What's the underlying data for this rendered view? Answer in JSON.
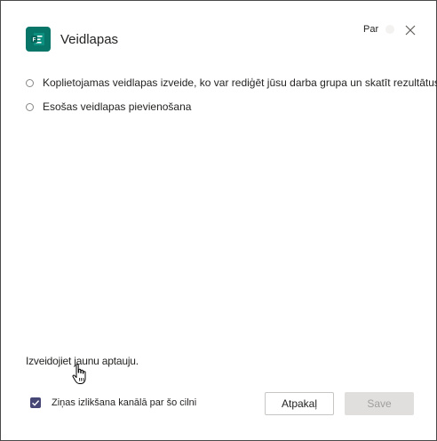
{
  "dialog": {
    "title": "Veidlapas",
    "about_label": "Par",
    "app_icon": "forms-icon",
    "close_icon": "close-icon",
    "brand_color": "#077568"
  },
  "options": [
    {
      "label": "Koplietojamas veidlapas izveide, ko var rediģēt jūsu darba grupa un skatīt rezultātus",
      "selected": false
    },
    {
      "label": "Esošas veidlapas pievienošana",
      "selected": false
    }
  ],
  "create_link": "Izveidojiet jaunu aptauju.",
  "post_to_channel": {
    "label": "Ziņas izlikšana kanālā par šo cilni",
    "checked": true,
    "check_color": "#464775"
  },
  "buttons": {
    "back": "Atpakaļ",
    "save": "Save"
  }
}
